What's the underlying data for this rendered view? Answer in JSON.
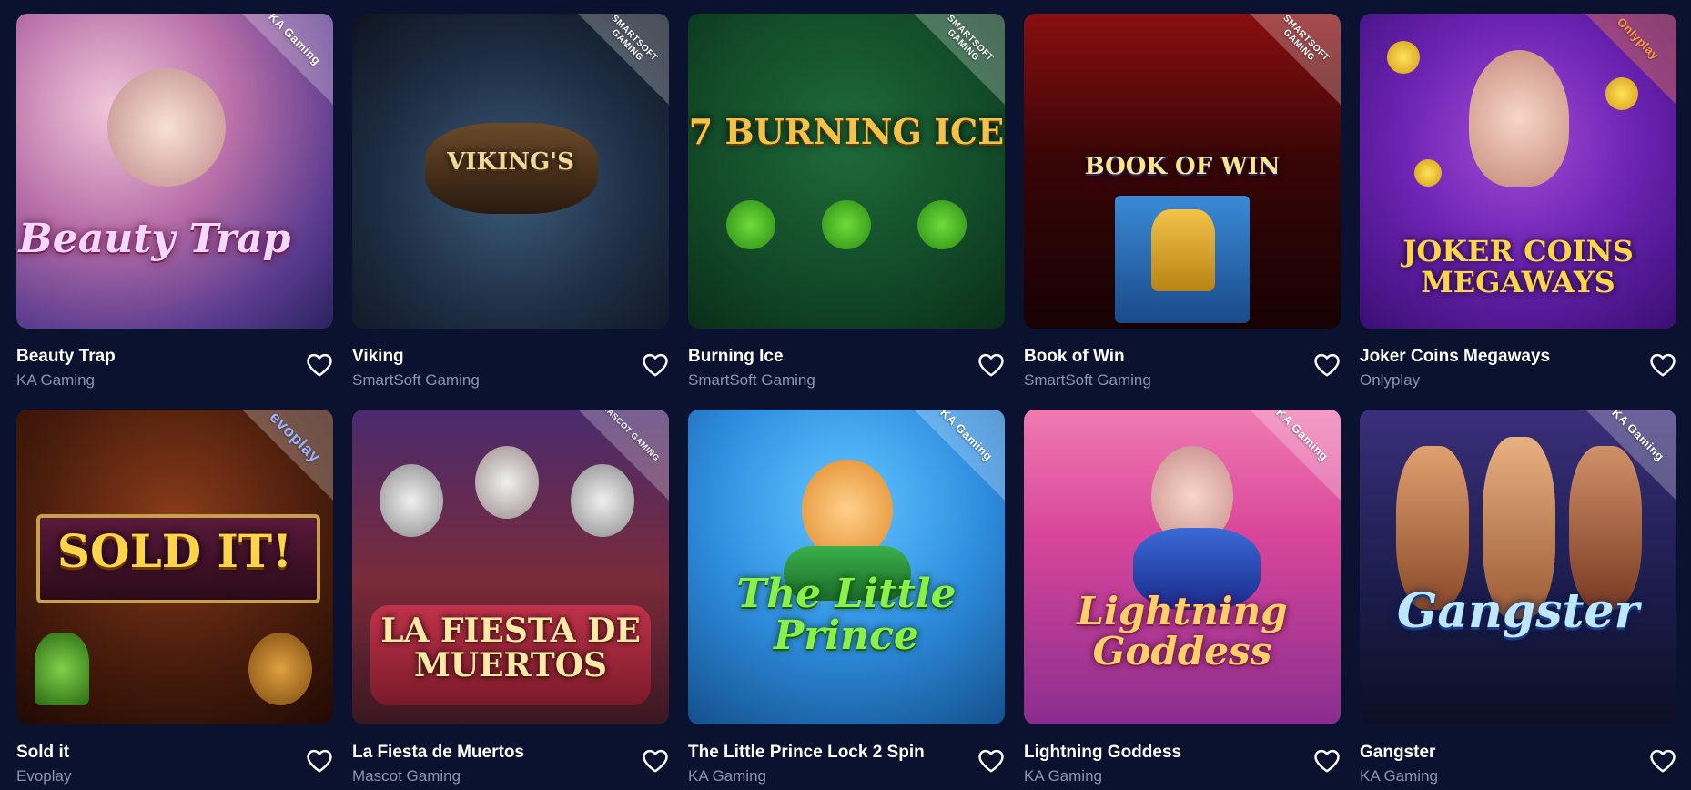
{
  "games": [
    {
      "name": "Beauty Trap",
      "provider": "KA Gaming",
      "art_title": "Beauty Trap",
      "badge": "KA Gaming",
      "accent": "#f0b7e0"
    },
    {
      "name": "Viking",
      "provider": "SmartSoft Gaming",
      "art_title": "VIKING'S",
      "badge": "SMARTSOFT GAMING",
      "accent": "#c7a64a"
    },
    {
      "name": "Burning Ice",
      "provider": "SmartSoft Gaming",
      "art_title": "7 BURNING ICE",
      "badge": "SMARTSOFT GAMING",
      "accent": "#f2c24a"
    },
    {
      "name": "Book of Win",
      "provider": "SmartSoft Gaming",
      "art_title": "BOOK OF WIN",
      "badge": "SMARTSOFT GAMING",
      "accent": "#ffd34a"
    },
    {
      "name": "Joker Coins Megaways",
      "provider": "Onlyplay",
      "art_title": "JOKER COINS MEGAWAYS",
      "badge": "Onlyplay",
      "accent": "#ffd34a"
    },
    {
      "name": "Sold it",
      "provider": "Evoplay",
      "art_title": "SOLD IT!",
      "badge": "evoplay",
      "accent": "#f2c24a"
    },
    {
      "name": "La Fiesta de Muertos",
      "provider": "Mascot Gaming",
      "art_title": "LA FIESTA DE MUERTOS",
      "badge": "MASCOT GAMING",
      "accent": "#ffd34a"
    },
    {
      "name": "The Little Prince Lock 2 Spin",
      "provider": "KA Gaming",
      "art_title": "The Little Prince",
      "badge": "KA Gaming",
      "accent": "#8af04a"
    },
    {
      "name": "Lightning Goddess",
      "provider": "KA Gaming",
      "art_title": "Lightning Goddess",
      "badge": "KA Gaming",
      "accent": "#ffcf6a"
    },
    {
      "name": "Gangster",
      "provider": "KA Gaming",
      "art_title": "Gangster",
      "badge": "KA Gaming",
      "accent": "#bde7ff"
    }
  ],
  "colors": {
    "background": "#0b1230",
    "title": "#ffffff",
    "provider": "#8d93ab",
    "heart": "#ffffff"
  },
  "icons": {
    "favorite": "heart-outline-icon"
  }
}
